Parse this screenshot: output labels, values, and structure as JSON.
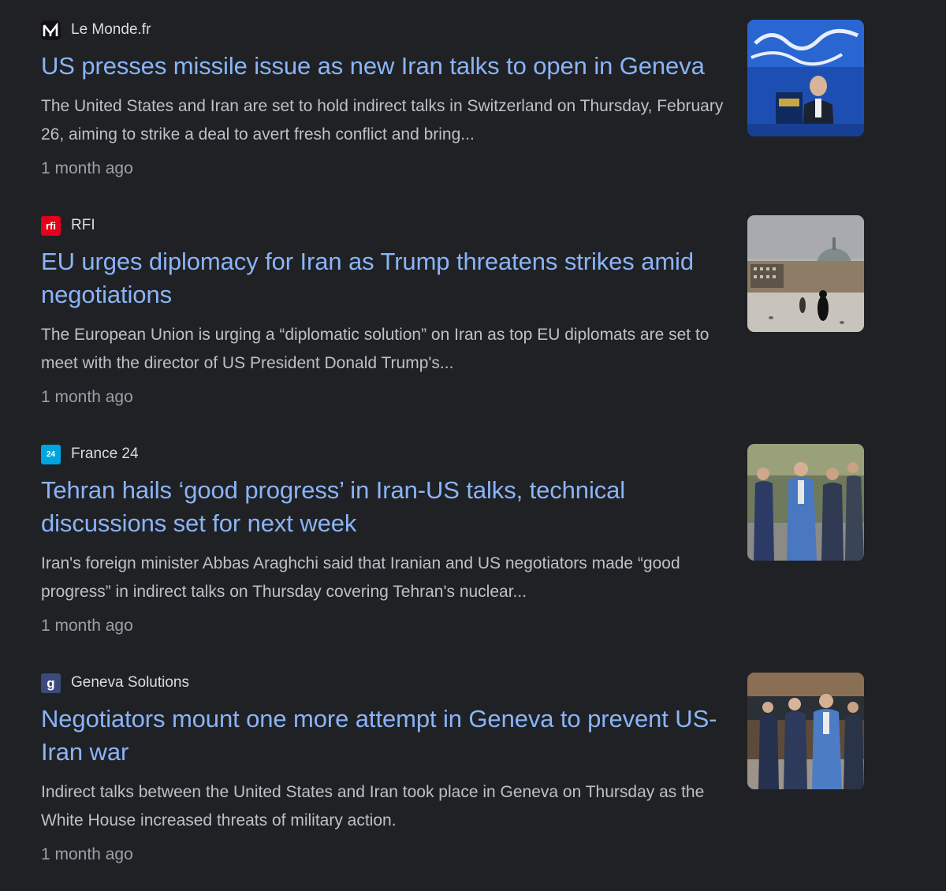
{
  "articles": [
    {
      "source": "Le Monde.fr",
      "title": "US presses missile issue as new Iran talks to open in Geneva",
      "snippet": "The United States and Iran are set to hold indirect talks in Switzerland on Thursday, February 26, aiming to strike a deal to avert fresh conflict and bring...",
      "time": "1 month ago",
      "logo_icon": "le-monde-logo-icon",
      "thumbnail": "speaker-at-podium-thumbnail"
    },
    {
      "source": "RFI",
      "title": "EU urges diplomacy for Iran as Trump threatens strikes amid negotiations",
      "snippet": "The European Union is urging a “diplomatic solution” on Iran as top EU diplomats are set to meet with the director of US President Donald Trump's...",
      "time": "1 month ago",
      "logo_icon": "rfi-logo-icon",
      "thumbnail": "mosque-square-thumbnail"
    },
    {
      "source": "France 24",
      "title": "Tehran hails ‘good progress’ in Iran-US talks, technical discussions set for next week",
      "snippet": "Iran's foreign minister Abbas Araghchi said that Iranian and US negotiators made “good progress” in indirect talks on Thursday covering Tehran's nuclear...",
      "time": "1 month ago",
      "logo_icon": "france24-logo-icon",
      "thumbnail": "delegation-walking-thumbnail"
    },
    {
      "source": "Geneva Solutions",
      "title": "Negotiators mount one more attempt in Geneva to prevent US-Iran war",
      "snippet": "Indirect talks between the United States and Iran took place in Geneva on Thursday as the White House increased threats of military action.",
      "time": "1 month ago",
      "logo_icon": "geneva-solutions-logo-icon",
      "thumbnail": "diplomats-group-thumbnail"
    }
  ],
  "logo_texts": {
    "rfi": "rfi",
    "france24": "24",
    "geneva": "g"
  },
  "colors": {
    "background": "#202124",
    "headline": "#8ab4f8",
    "source": "#dadce0",
    "snippet": "#bdc1c6",
    "time": "#9aa0a6",
    "rfi_red": "#e2001a",
    "france24_blue": "#00a5e0"
  }
}
